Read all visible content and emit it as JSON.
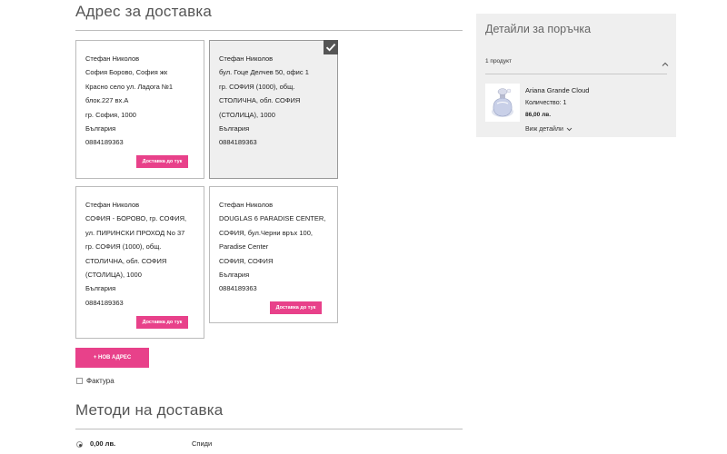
{
  "delivery_address": {
    "title": "Адрес за доставка",
    "cards": [
      {
        "lines": [
          "Стефан Николов",
          "София Борово, София жк",
          "Красно село ул. Ладога №1",
          "блок.227 вх.А",
          "гр. София, 1000",
          "България",
          "0884189363"
        ],
        "button_label": "Доставка до тук",
        "selected": false
      },
      {
        "lines": [
          "Стефан Николов",
          "бул. Гоце Делчев 50, офис 1",
          "гр. СОФИЯ (1000), общ.",
          "СТОЛИЧНА, обл. СОФИЯ",
          "(СТОЛИЦА), 1000",
          "България",
          "0884189363"
        ],
        "selected": true
      },
      {
        "lines": [
          "Стефан Николов",
          "СОФИЯ - БОРОВО, гр. СОФИЯ,",
          "ул. ПИРИНСКИ ПРОХОД No 37",
          "гр. СОФИЯ (1000), общ.",
          "СТОЛИЧНА, обл. СОФИЯ",
          "(СТОЛИЦА), 1000",
          "България",
          "0884189363"
        ],
        "button_label": "Доставка до тук",
        "selected": false
      },
      {
        "lines": [
          "Стефан Николов",
          "DOUGLAS 6 PARADISE CENTER,",
          "СОФИЯ, бул.Черни връх 100,",
          "Paradise Center",
          "СОФИЯ, СОФИЯ",
          "България",
          "0884189363"
        ],
        "button_label": "Доставка до тук",
        "selected": false
      }
    ],
    "new_address_label": "+ НОВ АДРЕС",
    "invoice_label": "Фактура"
  },
  "shipping_methods": {
    "title": "Методи на доставка",
    "options": [
      {
        "price": "0,00 лв.",
        "carrier": "Спиди",
        "selected": true
      }
    ]
  },
  "order_summary": {
    "title": "Детайли за поръчка",
    "product_count": "1 продукт",
    "item": {
      "name": "Ariana Grande Cloud",
      "quantity": "Количество: 1",
      "price": "86,00 лв."
    },
    "details_link": "Виж детайли"
  },
  "colors": {
    "accent": "#e8418a",
    "selected_card_bg": "#efefef",
    "summary_bg": "#efefef"
  }
}
